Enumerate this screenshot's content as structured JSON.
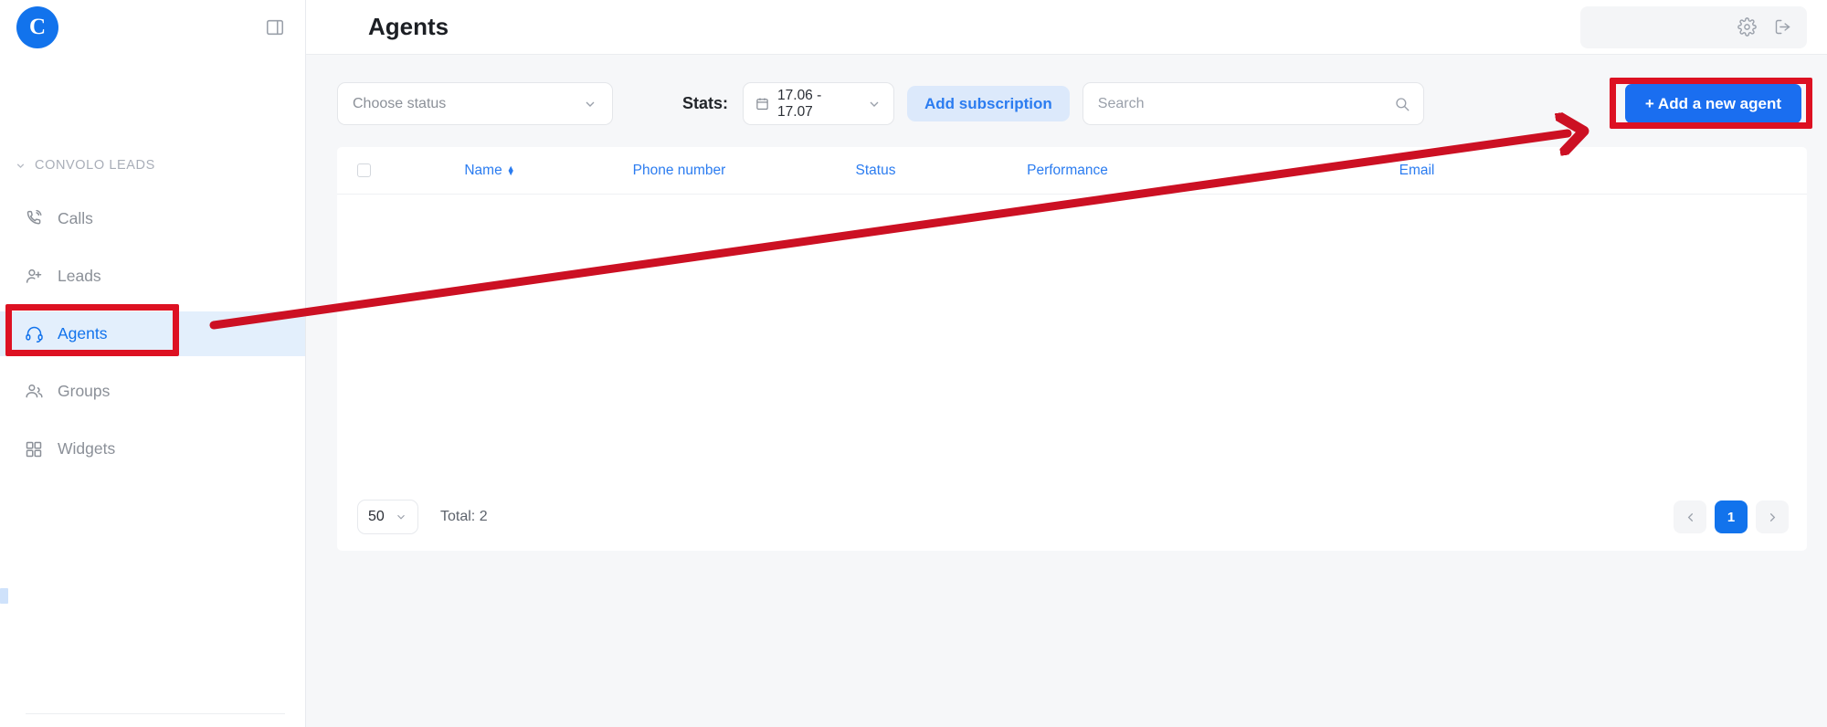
{
  "brand": {
    "logo_letter": "C",
    "accent": "#1273ec",
    "highlight": "#dd1122"
  },
  "sidebar": {
    "panel_toggle_icon": "panel-toggle-icon",
    "section": {
      "label": "CONVOLO LEADS",
      "chevron_icon": "chevron-down-icon"
    },
    "items": [
      {
        "label": "Calls",
        "icon": "phone-call-icon",
        "active": false
      },
      {
        "label": "Leads",
        "icon": "user-plus-icon",
        "active": false
      },
      {
        "label": "Agents",
        "icon": "headset-icon",
        "active": true
      },
      {
        "label": "Groups",
        "icon": "users-icon",
        "active": false
      },
      {
        "label": "Widgets",
        "icon": "grid-squares-icon",
        "active": false
      }
    ]
  },
  "header": {
    "title": "Agents",
    "settings_icon": "gear-icon",
    "logout_icon": "logout-icon"
  },
  "toolbar": {
    "status_select": {
      "value": "Choose status",
      "chevron_icon": "chevron-down-icon"
    },
    "stats_label": "Stats:",
    "date_range": {
      "value": "17.06 - 17.07",
      "calendar_icon": "calendar-icon",
      "chevron_icon": "chevron-down-icon"
    },
    "add_subscription_label": "Add subscription",
    "search": {
      "value": "",
      "placeholder": "Search",
      "icon": "search-icon"
    },
    "add_agent_label": "+ Add a new agent"
  },
  "table": {
    "select_all_checkbox": "select-all-checkbox",
    "columns": [
      {
        "label": "Name",
        "sortable": true,
        "sort_icon": "sort-arrows-icon"
      },
      {
        "label": "Phone number",
        "sortable": false
      },
      {
        "label": "Status",
        "sortable": false
      },
      {
        "label": "Performance",
        "sortable": false
      },
      {
        "label": "Email",
        "sortable": false
      }
    ],
    "rows": []
  },
  "footer": {
    "per_page": {
      "value": "50",
      "chevron_icon": "chevron-down-icon"
    },
    "total_label": "Total: 2",
    "pagination": {
      "prev_icon": "chevron-left-icon",
      "next_icon": "chevron-right-icon",
      "current_page": "1"
    }
  },
  "annotations": {
    "highlight_agents": "red box around Agents sidebar item",
    "highlight_add_agent": "red box around Add a new agent button",
    "arrow": "red arrow from Agents sidebar item to Add a new agent button"
  }
}
